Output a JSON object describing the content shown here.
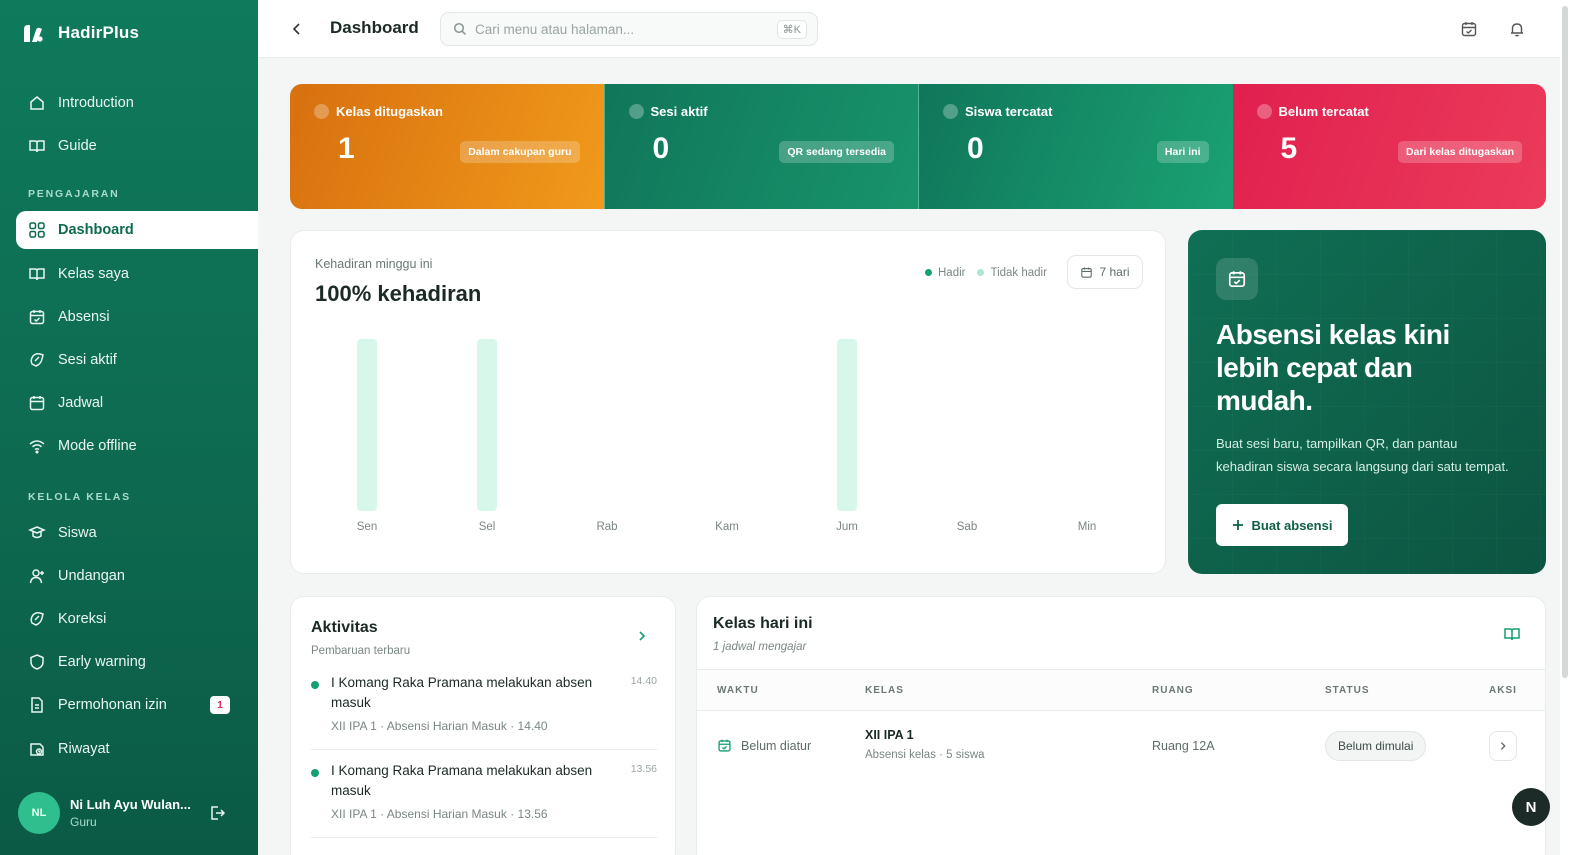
{
  "brand": {
    "name": "HadirPlus"
  },
  "sidebar": {
    "items_top": [
      {
        "label": "Introduction",
        "icon": "home-icon"
      },
      {
        "label": "Guide",
        "icon": "book-open-icon"
      }
    ],
    "section_pengajaran": "PENGAJARAN",
    "items_pengajaran": [
      {
        "label": "Dashboard",
        "icon": "grid-icon"
      },
      {
        "label": "Kelas saya",
        "icon": "book-open-icon"
      },
      {
        "label": "Absensi",
        "icon": "calendar-check-icon"
      },
      {
        "label": "Sesi aktif",
        "icon": "session-icon"
      },
      {
        "label": "Jadwal",
        "icon": "calendar-icon"
      },
      {
        "label": "Mode offline",
        "icon": "wifi-icon"
      }
    ],
    "section_kelola": "KELOLA KELAS",
    "items_kelola": [
      {
        "label": "Siswa",
        "icon": "users-icon"
      },
      {
        "label": "Undangan",
        "icon": "user-plus-icon"
      },
      {
        "label": "Koreksi",
        "icon": "edit-icon"
      },
      {
        "label": "Early warning",
        "icon": "shield-icon"
      },
      {
        "label": "Permohonan izin",
        "icon": "file-icon",
        "badge": "1"
      },
      {
        "label": "Riwayat",
        "icon": "history-icon"
      }
    ],
    "user": {
      "initials": "NL",
      "name": "Ni Luh Ayu Wulan...",
      "role": "Guru"
    }
  },
  "topbar": {
    "title": "Dashboard",
    "search_placeholder": "Cari menu atau halaman...",
    "shortcut": "⌘K"
  },
  "stats": [
    {
      "label": "Kelas ditugaskan",
      "value": "1",
      "pill": "Dalam cakupan guru",
      "color": "#e8851a"
    },
    {
      "label": "Sesi aktif",
      "value": "0",
      "pill": "QR sedang tersedia",
      "color": "#12805f"
    },
    {
      "label": "Siswa tercatat",
      "value": "0",
      "pill": "Hari ini",
      "color": "#14916a"
    },
    {
      "label": "Belum tercatat",
      "value": "5",
      "pill": "Dari kelas ditugaskan",
      "color": "#e3264f"
    }
  ],
  "attendance": {
    "subtitle": "Kehadiran minggu ini",
    "headline": "100% kehadiran",
    "legend_hadir": "Hadir",
    "legend_tidak": "Tidak hadir",
    "range": "7 hari"
  },
  "chart_data": {
    "type": "bar",
    "categories": [
      "Sen",
      "Sel",
      "Rab",
      "Kam",
      "Jum",
      "Sab",
      "Min"
    ],
    "series": [
      {
        "name": "Hadir",
        "values": [
          1,
          1,
          0,
          0,
          1,
          0,
          0
        ],
        "color": "#d7f7ea"
      },
      {
        "name": "Tidak hadir",
        "values": [
          0,
          0,
          0,
          0,
          0,
          0,
          0
        ],
        "color": "#a8e8cf"
      }
    ],
    "ylim": [
      0,
      1
    ],
    "grid": false,
    "legend": "top-right"
  },
  "promo": {
    "title": "Absensi kelas kini lebih cepat dan mudah.",
    "text": "Buat sesi baru, tampilkan QR, dan pantau kehadiran siswa secara langsung dari satu tempat.",
    "button": "Buat absensi"
  },
  "aktivitas": {
    "title": "Aktivitas",
    "subtitle": "Pembaruan terbaru",
    "items": [
      {
        "msg": "I Komang Raka Pramana melakukan absen masuk",
        "time": "14.40",
        "meta": "XII IPA 1 · Absensi Harian Masuk · 14.40"
      },
      {
        "msg": "I Komang Raka Pramana melakukan absen masuk",
        "time": "13.56",
        "meta": "XII IPA 1 · Absensi Harian Masuk · 13.56"
      }
    ]
  },
  "kelas": {
    "title": "Kelas hari ini",
    "subtitle": "1 jadwal mengajar",
    "headers": {
      "waktu": "WAKTU",
      "kelas": "KELAS",
      "ruang": "RUANG",
      "status": "STATUS",
      "aksi": "AKSI"
    },
    "rows": [
      {
        "waktu": "Belum diatur",
        "kelas": "XII IPA 1",
        "kelas_meta": "Absensi kelas · 5 siswa",
        "ruang": "Ruang 12A",
        "status": "Belum dimulai"
      }
    ]
  },
  "fab": {
    "label": "N"
  }
}
